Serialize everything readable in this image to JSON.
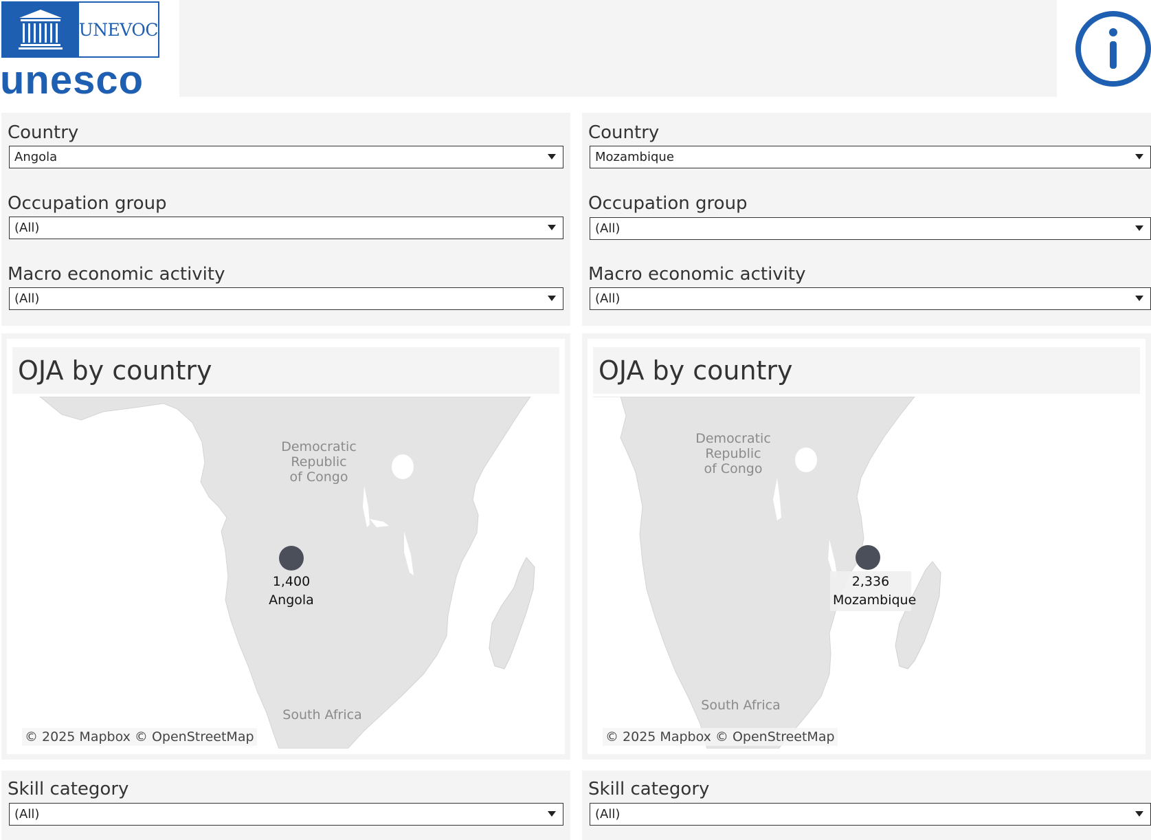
{
  "header": {
    "logo_top_right": "UNEVOC",
    "logo_temple_text": "UNESCO",
    "logo_word": "unesco",
    "info_icon": "info-icon"
  },
  "left": {
    "filters": {
      "country_label": "Country",
      "country_value": "Angola",
      "occupation_label": "Occupation group",
      "occupation_value": "(All)",
      "macro_label": "Macro economic activity",
      "macro_value": "(All)"
    },
    "map": {
      "title": "OJA by country",
      "bg_label_drc": "Democratic\nRepublic\nof Congo",
      "bg_label_sa": "South Africa",
      "marker_value": "1,400",
      "marker_country": "Angola",
      "attribution": "© 2025 Mapbox  © OpenStreetMap"
    },
    "skill_label": "Skill category",
    "skill_value": "(All)"
  },
  "right": {
    "filters": {
      "country_label": "Country",
      "country_value": "Mozambique",
      "occupation_label": "Occupation group",
      "occupation_value": "(All)",
      "macro_label": "Macro economic activity",
      "macro_value": "(All)"
    },
    "map": {
      "title": "OJA by country",
      "bg_label_drc": "Democratic\nRepublic\nof Congo",
      "bg_label_sa": "South Africa",
      "marker_value": "2,336",
      "marker_country": "Mozambique",
      "attribution": "© 2025 Mapbox  © OpenStreetMap"
    },
    "skill_label": "Skill category",
    "skill_value": "(All)"
  },
  "colors": {
    "brand_blue": "#1f5fb1",
    "panel_bg": "#f4f4f4",
    "land": "#e4e4e4",
    "marker": "#4a4f5a"
  }
}
